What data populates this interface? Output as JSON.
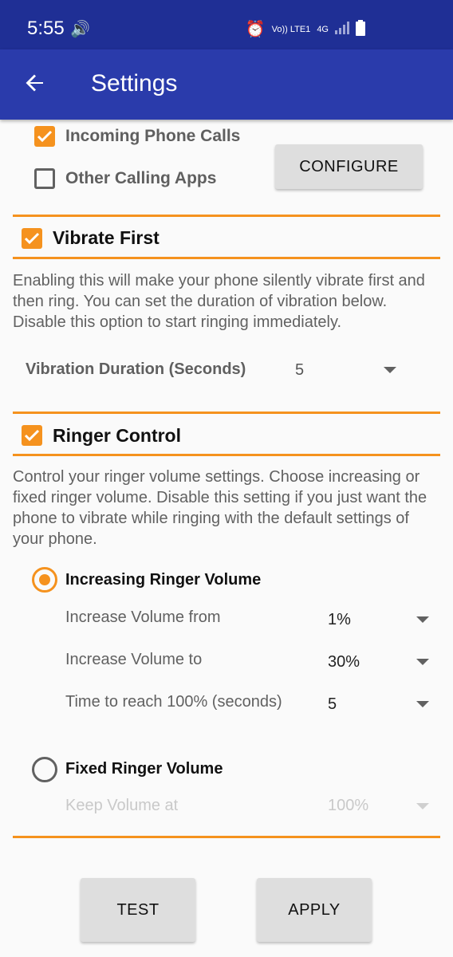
{
  "status_bar": {
    "time": "5:55",
    "network": "Vo)) LTE1",
    "net_type": "4G"
  },
  "app_bar": {
    "title": "Settings"
  },
  "calls": {
    "incoming_label": "Incoming Phone Calls",
    "other_label": "Other Calling Apps",
    "configure_label": "CONFIGURE"
  },
  "vibrate": {
    "title": "Vibrate First",
    "description": "Enabling this will make your phone silently vibrate first and then ring. You can set the duration of vibration below. Disable this option to start ringing immediately.",
    "duration_label": "Vibration Duration (Seconds)",
    "duration_value": "5"
  },
  "ringer": {
    "title": "Ringer Control",
    "description": "Control your ringer volume settings. Choose increasing or fixed ringer volume. Disable this setting if you just want the phone to vibrate while ringing with the default settings of your phone.",
    "increasing_label": "Increasing Ringer Volume",
    "from_label": "Increase Volume from",
    "from_value": "1%",
    "to_label": "Increase Volume to",
    "to_value": "30%",
    "time_label": "Time to reach 100% (seconds)",
    "time_value": "5",
    "fixed_label": "Fixed Ringer Volume",
    "keep_label": "Keep Volume at",
    "keep_value": "100%"
  },
  "actions": {
    "test_label": "TEST",
    "apply_label": "APPLY"
  },
  "colors": {
    "accent": "#f5921e",
    "appbar": "#2a3bab",
    "statusbar": "#1f2f95"
  }
}
